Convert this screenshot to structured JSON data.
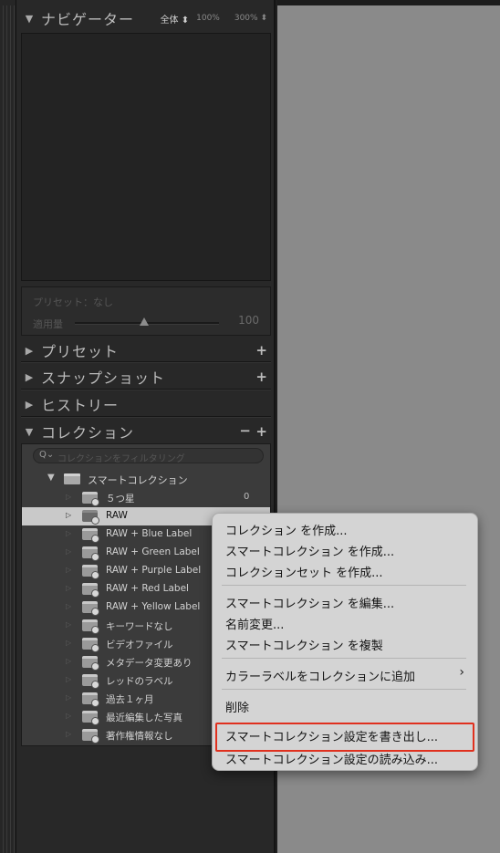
{
  "navigator": {
    "title": "ナビゲーター",
    "opt_fit": "全体",
    "opt_100": "100%",
    "opt_300": "300%"
  },
  "preset_box": {
    "preset_label": "プリセット：なし",
    "amount_label": "適用量",
    "amount_value": "100"
  },
  "panels": {
    "presets": "プリセット",
    "snapshots": "スナップショット",
    "history": "ヒストリー",
    "collections": "コレクション"
  },
  "collections": {
    "search_placeholder": "コレクションをフィルタリング",
    "group_label": "スマートコレクション",
    "items": [
      {
        "label": "５つ星",
        "count": "0"
      },
      {
        "label": "RAW",
        "count": ""
      },
      {
        "label": "RAW + Blue Label",
        "count": ""
      },
      {
        "label": "RAW + Green Label",
        "count": ""
      },
      {
        "label": "RAW + Purple Label",
        "count": ""
      },
      {
        "label": "RAW + Red Label",
        "count": ""
      },
      {
        "label": "RAW + Yellow Label",
        "count": ""
      },
      {
        "label": "キーワードなし",
        "count": ""
      },
      {
        "label": "ビデオファイル",
        "count": ""
      },
      {
        "label": "メタデータ変更あり",
        "count": ""
      },
      {
        "label": "レッドのラベル",
        "count": ""
      },
      {
        "label": "過去１ヶ月",
        "count": ""
      },
      {
        "label": "最近編集した写真",
        "count": ""
      },
      {
        "label": "著作権情報なし",
        "count": ""
      }
    ]
  },
  "context_menu": {
    "items": [
      "コレクション を作成...",
      "スマートコレクション を作成...",
      "コレクションセット を作成...",
      "スマートコレクション を編集...",
      "名前変更...",
      "スマートコレクション を複製",
      "カラーラベルをコレクションに追加",
      "削除",
      "スマートコレクション設定を書き出し...",
      "スマートコレクション設定の読み込み..."
    ],
    "highlighted_color": "#e0301e"
  }
}
